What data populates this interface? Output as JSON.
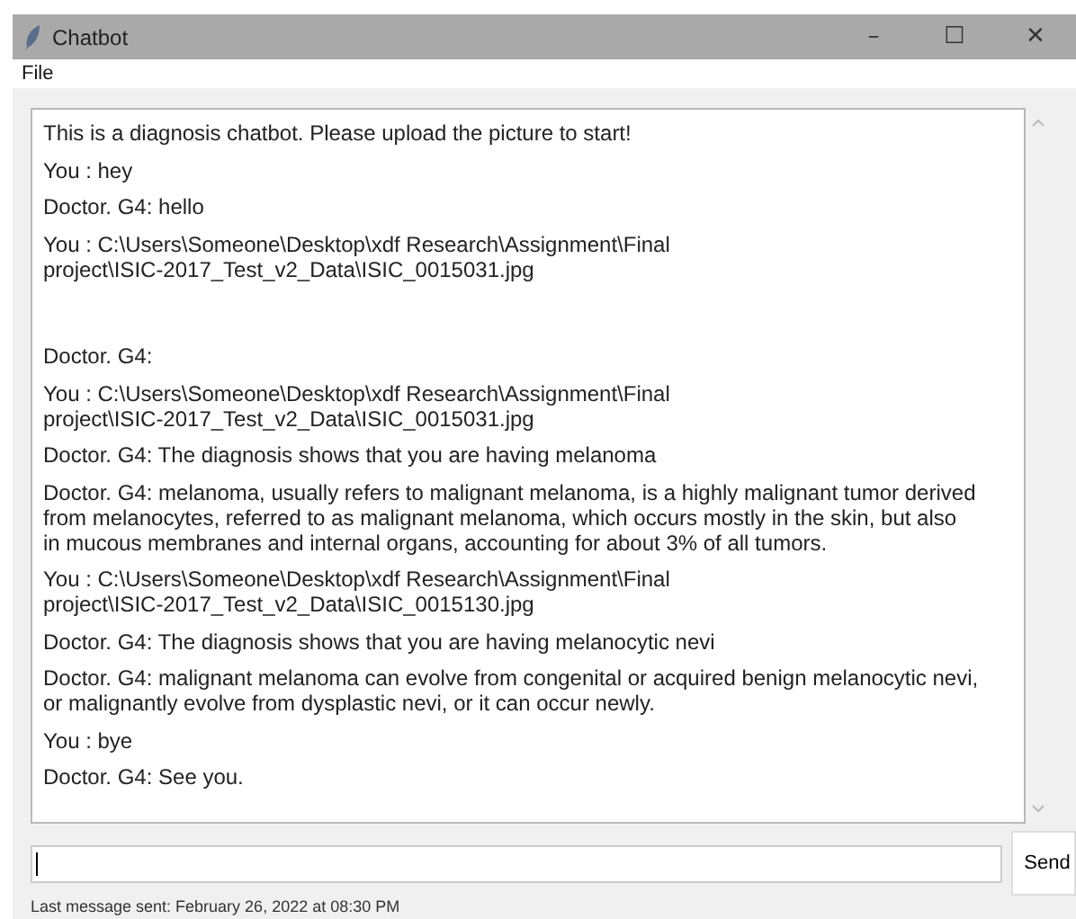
{
  "window": {
    "title": "Chatbot",
    "controls": [
      "–",
      "☐",
      "✕"
    ]
  },
  "menu": [
    "File"
  ],
  "messages": [
    {
      "kind": "text",
      "text": "This is a diagnosis chatbot. Please upload the picture to start!"
    },
    {
      "kind": "text",
      "text": "You : hey"
    },
    {
      "kind": "text",
      "text": "Doctor. G4: hello"
    },
    {
      "kind": "text",
      "text": "You : C:\\Users\\Someone\\Desktop\\xdf Research\\Assignment\\Final\nproject\\ISIC-2017_Test_v2_Data\\ISIC_0015031.jpg"
    },
    {
      "kind": "gap"
    },
    {
      "kind": "text",
      "text": "Doctor. G4:"
    },
    {
      "kind": "text",
      "text": "You : C:\\Users\\Someone\\Desktop\\xdf Research\\Assignment\\Final\nproject\\ISIC-2017_Test_v2_Data\\ISIC_0015031.jpg"
    },
    {
      "kind": "text",
      "text": "Doctor. G4: The diagnosis shows that you are having melanoma"
    },
    {
      "kind": "text",
      "text": "Doctor. G4: melanoma, usually refers to malignant melanoma, is a highly malignant tumor derived\nfrom melanocytes, referred to as malignant melanoma, which occurs mostly in the skin, but also\nin mucous membranes and internal organs, accounting for about 3% of all tumors."
    },
    {
      "kind": "text",
      "text": "You : C:\\Users\\Someone\\Desktop\\xdf Research\\Assignment\\Final\nproject\\ISIC-2017_Test_v2_Data\\ISIC_0015130.jpg"
    },
    {
      "kind": "text",
      "text": "Doctor. G4: The diagnosis shows that you are having melanocytic nevi"
    },
    {
      "kind": "text",
      "text": "Doctor. G4: malignant melanoma can evolve from congenital or acquired benign melanocytic nevi,\nor malignantly evolve from dysplastic nevi, or it can occur newly."
    },
    {
      "kind": "text",
      "text": "You : bye"
    },
    {
      "kind": "text",
      "text": "Doctor. G4: See you."
    }
  ],
  "send_button": "Send",
  "status_bar": "Last message sent: February 26, 2022 at 08:30 PM"
}
